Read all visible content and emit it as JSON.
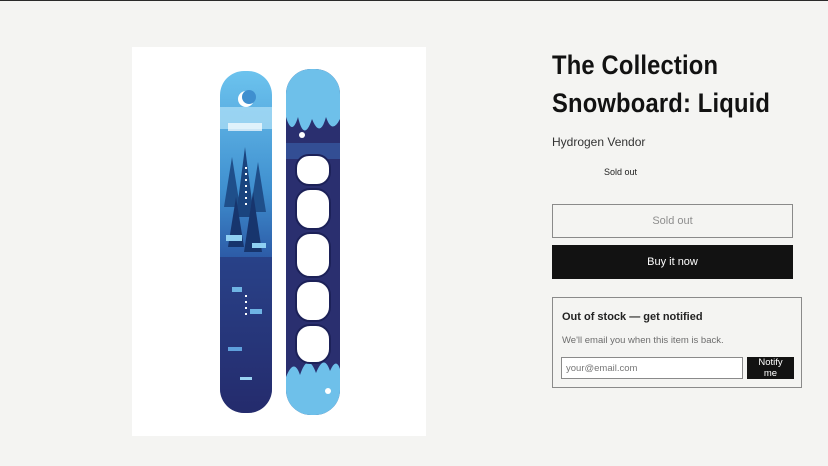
{
  "product": {
    "title_line1": "The Collection",
    "title_line2": "Snowboard: Liquid",
    "vendor": "Hydrogen Vendor",
    "badge": "Sold out",
    "image_alt": "Liquid snowboard top and base"
  },
  "actions": {
    "soldout_label": "Sold out",
    "buy_label": "Buy it now"
  },
  "notify": {
    "title": "Out of stock — get notified",
    "description": "We'll email you when this item is back.",
    "email_placeholder": "your@email.com",
    "email_value": "",
    "button_label": "Notify me"
  },
  "colors": {
    "background": "#f4f4f2",
    "text": "#121212",
    "button_dark": "#121212",
    "border": "#8a8a8a",
    "board_light_blue": "#5fb6e6",
    "board_navy": "#2a2f6f"
  }
}
